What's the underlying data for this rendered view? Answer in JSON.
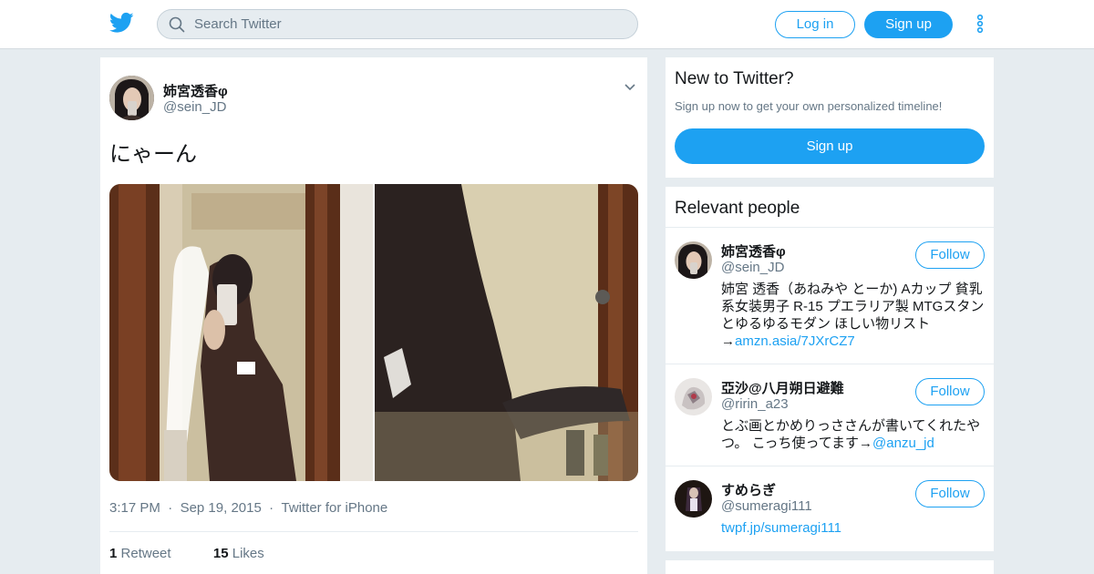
{
  "header": {
    "logo_icon": "twitter-bird-icon",
    "search": {
      "placeholder": "Search Twitter",
      "value": ""
    },
    "login_label": "Log in",
    "signup_label": "Sign up",
    "more_icon": "vertical-dots-icon"
  },
  "tweet": {
    "author_name": "姉宮透香φ",
    "author_handle": "@sein_JD",
    "text": "にゃーん",
    "media_count": 2,
    "time": "3:17 PM",
    "date": "Sep 19, 2015",
    "source": "Twitter for iPhone",
    "retweet_count": "1",
    "retweet_label": "Retweet",
    "like_count": "15",
    "like_label": "Likes"
  },
  "sidebar": {
    "new_to_twitter": {
      "title": "New to Twitter?",
      "subtitle": "Sign up now to get your own personalized timeline!",
      "button_label": "Sign up"
    },
    "relevant_people": {
      "title": "Relevant people",
      "people": [
        {
          "name": "姉宮透香φ",
          "handle": "@sein_JD",
          "bio": "姉宮 透香（あねみや とーか) Aカップ 貧乳系女装男子 R-15 プエラリア製 MTGスタンとゆるゆるモダン ほしい物リスト→",
          "bio_link": "amzn.asia/7JXrCZ7",
          "follow_label": "Follow"
        },
        {
          "name": "亞沙@八月朔日避難",
          "handle": "@ririn_a23",
          "bio": "とぶ画とかめりっささんが書いてくれたやつ。 こっち使ってます→",
          "bio_link": "@anzu_jd",
          "follow_label": "Follow"
        },
        {
          "name": "すめらぎ",
          "handle": "@sumeragi111",
          "bio": "",
          "bio_link": "twpf.jp/sumeragi111",
          "follow_label": "Follow"
        }
      ]
    }
  },
  "colors": {
    "accent": "#1da1f2",
    "background": "#e6ecf0",
    "secondary_text": "#657786",
    "primary_text": "#14171a"
  }
}
